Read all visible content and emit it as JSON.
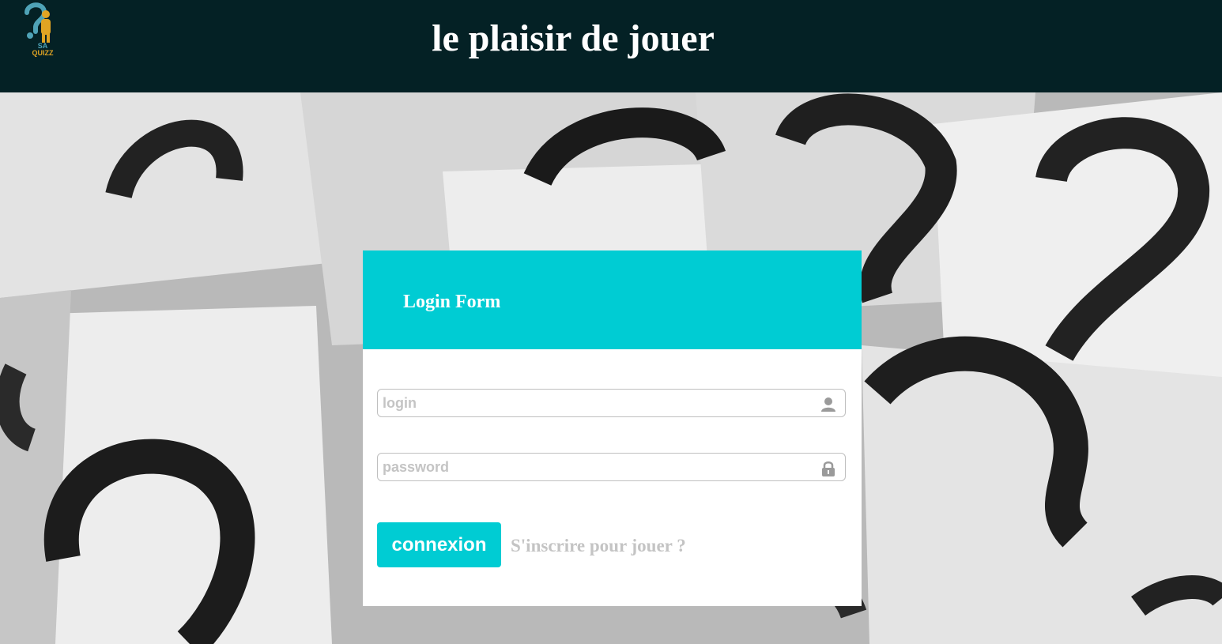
{
  "header": {
    "title": "le plaisir de jouer",
    "logo": {
      "icon": "question-mark-person-logo-icon",
      "line1": "SA",
      "line2": "QUIZZ"
    },
    "background_color": "#042125"
  },
  "background": {
    "icon": "question-marks-photo"
  },
  "login_form": {
    "title": "Login Form",
    "login_placeholder": "login",
    "login_value": "",
    "login_icon": "user-icon",
    "password_placeholder": "password",
    "password_value": "",
    "password_icon": "lock-icon",
    "submit_label": "connexion",
    "register_link_label": "S'inscrire pour jouer ?",
    "accent_color": "#00ccd3"
  }
}
